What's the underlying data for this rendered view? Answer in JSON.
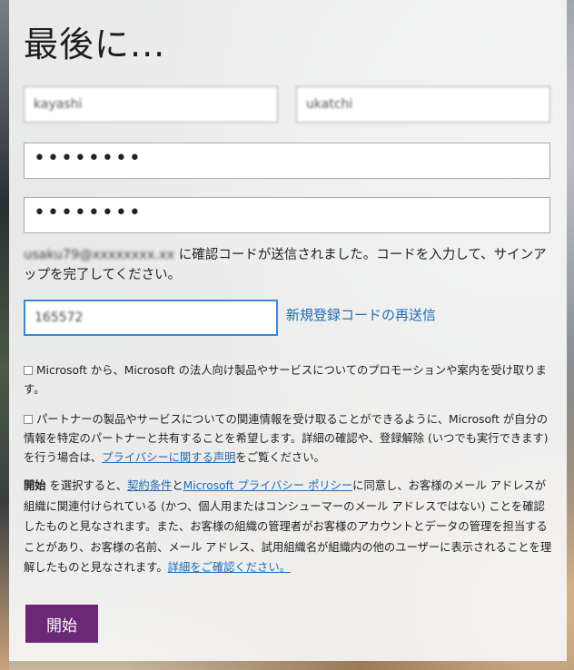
{
  "page": {
    "title": "最後に..."
  },
  "form": {
    "first_name_value": "kayashi",
    "last_name_value": "ukatchi",
    "password_value": "••••••••",
    "confirm_password_value": "••••••••",
    "message_email": "usaku79@xxxxxxxx.xx",
    "message_text": " に確認コードが送信されました。コードを入力して、サインアップを完了してください。",
    "code_value": "165572",
    "resend_link": "新規登録コードの再送信"
  },
  "consents": {
    "microsoft_promo": "Microsoft から、Microsoft の法人向け製品やサービスについてのプロモーションや案内を受け取ります。",
    "partner_text_1": "パートナーの製品やサービスについての関連情報を受け取ることができるように、Microsoft が自分の情報を特定のパートナーと共有することを希望します。詳細の確認や、登録解除 (いつでも実行できます) を行う場合は、",
    "partner_link": "プライバシーに関する声明",
    "partner_text_2": "をご覧ください。"
  },
  "legal": {
    "lead_bold": "開始",
    "text_1": " を選択すると、",
    "terms_link": "契約条件",
    "text_2": "と",
    "privacy_link": "Microsoft プライバシー ポリシー",
    "text_3": "に同意し、お客様のメール アドレスが組織に関連付けられている (かつ、個人用またはコンシューマーのメール アドレスではない) ことを確認したものと見なされます。また、お客様の組織の管理者がお客様のアカウントとデータの管理を担当することがあり、お客様の名前、メール アドレス、試用組織名が組織内の他のユーザーに表示されることを理解したものと見なされます。",
    "details_link": "詳細をご確認ください。"
  },
  "actions": {
    "start_label": "開始"
  },
  "colors": {
    "accent": "#6b2876",
    "link": "#1f6cb3",
    "focus_border": "#3b86d8"
  }
}
